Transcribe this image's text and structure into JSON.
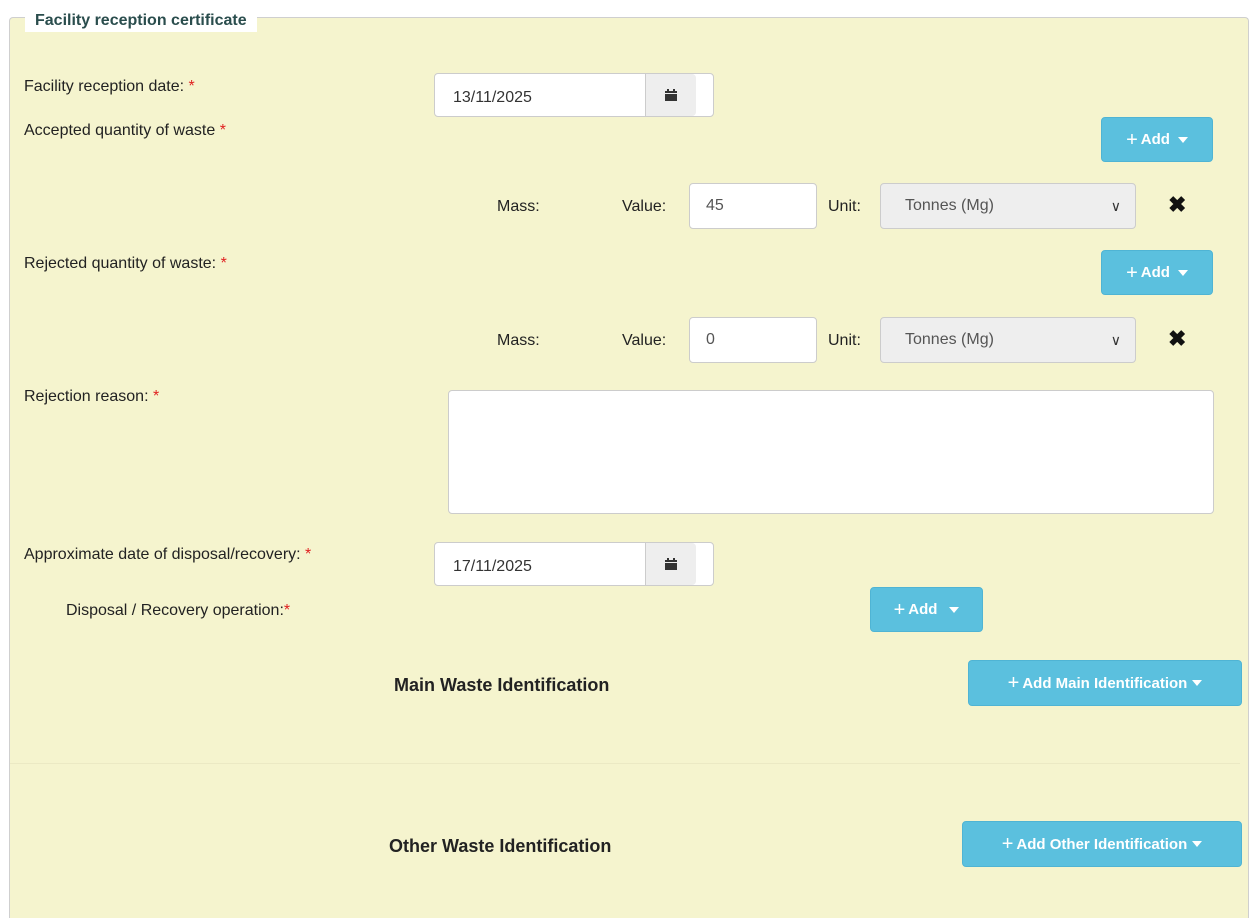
{
  "legend": "Facility reception certificate",
  "required_mark": "*",
  "reception_date": {
    "label": "Facility reception date:",
    "value": "13/11/2025",
    "icon": "calendar-icon"
  },
  "accepted": {
    "label": "Accepted quantity of waste",
    "add_label": "Add",
    "mass_label": "Mass:",
    "value_label": "Value:",
    "value": "45",
    "unit_label": "Unit:",
    "unit_value": "Tonnes (Mg)"
  },
  "rejected": {
    "label": "Rejected quantity of waste:",
    "add_label": "Add",
    "mass_label": "Mass:",
    "value_label": "Value:",
    "value": "0",
    "unit_label": "Unit:",
    "unit_value": "Tonnes (Mg)"
  },
  "rejection_reason": {
    "label": "Rejection reason:",
    "value": ""
  },
  "disposal_date": {
    "label": "Approximate date of disposal/recovery:",
    "value": "17/11/2025"
  },
  "operation": {
    "label": "Disposal / Recovery operation:",
    "add_label": "Add"
  },
  "main_identification": {
    "title": "Main Waste Identification",
    "add_label": "Add Main Identification"
  },
  "other_identification": {
    "title": "Other Waste Identification",
    "add_label": "Add Other Identification"
  },
  "colors": {
    "background": "#f5f4ce",
    "button": "#5bc0de",
    "required": "#e02020",
    "legend": "#2a4d4d"
  }
}
